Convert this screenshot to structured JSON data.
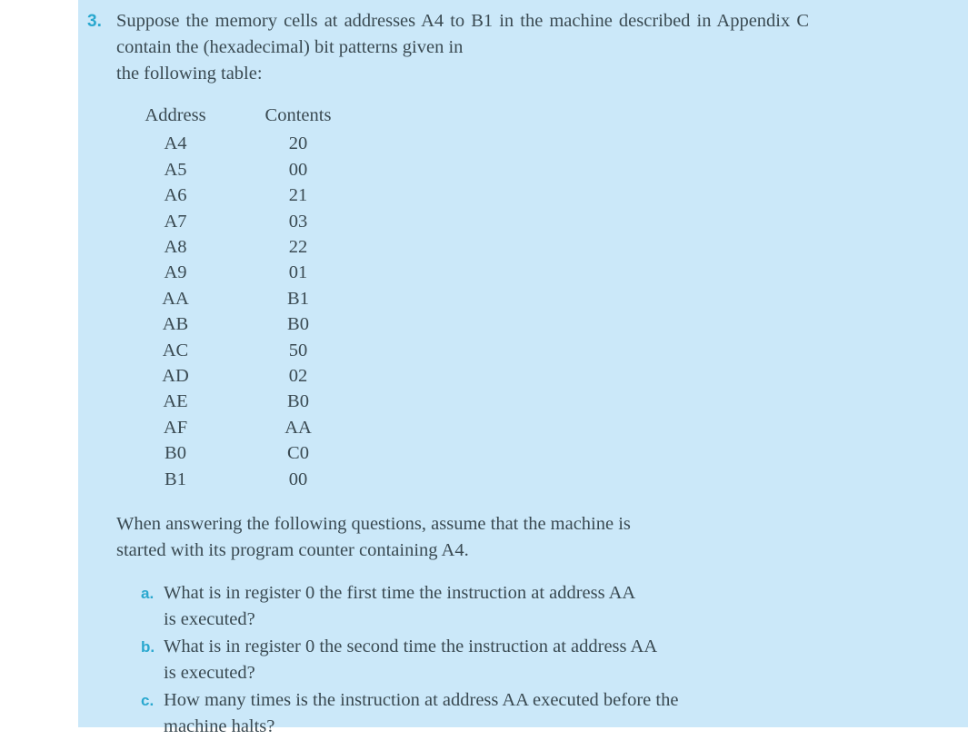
{
  "problem": {
    "number": "3.",
    "intro_line1": "Suppose the memory cells at addresses A4 to B1 in the machine",
    "intro_line2": "described in Appendix C contain the (hexadecimal) bit patterns given in",
    "intro_line3": "the following table:",
    "assume_line1": "When answering the following questions, assume that the machine is",
    "assume_line2": "started with its program counter containing A4."
  },
  "table": {
    "headers": {
      "address": "Address",
      "contents": "Contents"
    },
    "rows": [
      {
        "address": "A4",
        "contents": "20"
      },
      {
        "address": "A5",
        "contents": "00"
      },
      {
        "address": "A6",
        "contents": "21"
      },
      {
        "address": "A7",
        "contents": "03"
      },
      {
        "address": "A8",
        "contents": "22"
      },
      {
        "address": "A9",
        "contents": "01"
      },
      {
        "address": "AA",
        "contents": "B1"
      },
      {
        "address": "AB",
        "contents": "B0"
      },
      {
        "address": "AC",
        "contents": "50"
      },
      {
        "address": "AD",
        "contents": "02"
      },
      {
        "address": "AE",
        "contents": "B0"
      },
      {
        "address": "AF",
        "contents": "AA"
      },
      {
        "address": "B0",
        "contents": "C0"
      },
      {
        "address": "B1",
        "contents": "00"
      }
    ]
  },
  "subquestions": [
    {
      "letter": "a.",
      "line1": "What is in register 0 the first time the instruction at address AA",
      "line2": "is executed?"
    },
    {
      "letter": "b.",
      "line1": "What is in register 0 the second time the instruction at address AA",
      "line2": "is executed?"
    },
    {
      "letter": "c.",
      "line1": "How many times is the instruction at address AA executed before the",
      "line2": "machine halts?"
    }
  ],
  "colors": {
    "panel_background": "#cbe8f9",
    "page_background": "#ffffff",
    "body_text": "#3a4a52",
    "marker_accent": "#2aa8cf"
  }
}
